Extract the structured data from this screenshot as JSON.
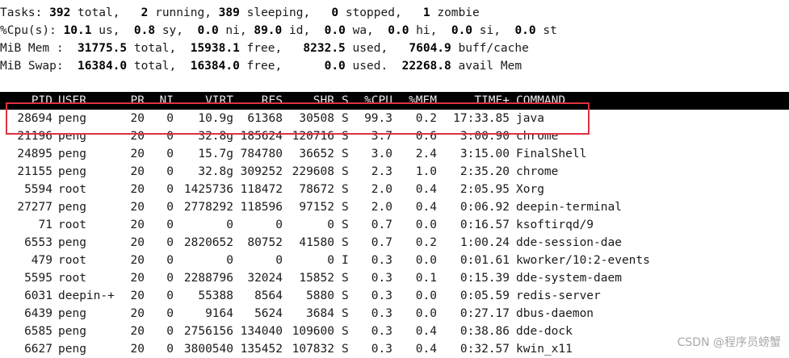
{
  "summary_lines": [
    [
      {
        "t": "Tasks: ",
        "b": false
      },
      {
        "t": "392",
        "b": true
      },
      {
        "t": " total,   ",
        "b": false
      },
      {
        "t": "2",
        "b": true
      },
      {
        "t": " running, ",
        "b": false
      },
      {
        "t": "389",
        "b": true
      },
      {
        "t": " sleeping,   ",
        "b": false
      },
      {
        "t": "0",
        "b": true
      },
      {
        "t": " stopped,   ",
        "b": false
      },
      {
        "t": "1",
        "b": true
      },
      {
        "t": " zombie",
        "b": false
      }
    ],
    [
      {
        "t": "%Cpu(s): ",
        "b": false
      },
      {
        "t": "10.1",
        "b": true
      },
      {
        "t": " us,  ",
        "b": false
      },
      {
        "t": "0.8",
        "b": true
      },
      {
        "t": " sy,  ",
        "b": false
      },
      {
        "t": "0.0",
        "b": true
      },
      {
        "t": " ni, ",
        "b": false
      },
      {
        "t": "89.0",
        "b": true
      },
      {
        "t": " id,  ",
        "b": false
      },
      {
        "t": "0.0",
        "b": true
      },
      {
        "t": " wa,  ",
        "b": false
      },
      {
        "t": "0.0",
        "b": true
      },
      {
        "t": " hi,  ",
        "b": false
      },
      {
        "t": "0.0",
        "b": true
      },
      {
        "t": " si,  ",
        "b": false
      },
      {
        "t": "0.0",
        "b": true
      },
      {
        "t": " st",
        "b": false
      }
    ],
    [
      {
        "t": "MiB Mem :  ",
        "b": false
      },
      {
        "t": "31775.5",
        "b": true
      },
      {
        "t": " total,  ",
        "b": false
      },
      {
        "t": "15938.1",
        "b": true
      },
      {
        "t": " free,   ",
        "b": false
      },
      {
        "t": "8232.5",
        "b": true
      },
      {
        "t": " used,   ",
        "b": false
      },
      {
        "t": "7604.9",
        "b": true
      },
      {
        "t": " buff/cache",
        "b": false
      }
    ],
    [
      {
        "t": "MiB Swap:  ",
        "b": false
      },
      {
        "t": "16384.0",
        "b": true
      },
      {
        "t": " total,  ",
        "b": false
      },
      {
        "t": "16384.0",
        "b": true
      },
      {
        "t": " free,      ",
        "b": false
      },
      {
        "t": "0.0",
        "b": true
      },
      {
        "t": " used.  ",
        "b": false
      },
      {
        "t": "22268.8",
        "b": true
      },
      {
        "t": " avail Mem",
        "b": false
      }
    ]
  ],
  "columns": {
    "pid": "PID",
    "user": "USER",
    "pr": "PR",
    "ni": "NI",
    "virt": "VIRT",
    "res": "RES",
    "shr": "SHR",
    "s": "S",
    "cpu": "%CPU",
    "mem": "%MEM",
    "time": "TIME+",
    "cmd": "COMMAND"
  },
  "processes": [
    {
      "pid": "28694",
      "user": "peng",
      "pr": "20",
      "ni": "0",
      "virt": "10.9g",
      "res": "61368",
      "shr": "30508",
      "s": "S",
      "cpu": "99.3",
      "mem": "0.2",
      "time": "17:33.85",
      "cmd": "java"
    },
    {
      "pid": "21196",
      "user": "peng",
      "pr": "20",
      "ni": "0",
      "virt": "32.8g",
      "res": "185624",
      "shr": "120716",
      "s": "S",
      "cpu": "3.7",
      "mem": "0.6",
      "time": "3:00.90",
      "cmd": "chrome"
    },
    {
      "pid": "24895",
      "user": "peng",
      "pr": "20",
      "ni": "0",
      "virt": "15.7g",
      "res": "784780",
      "shr": "36652",
      "s": "S",
      "cpu": "3.0",
      "mem": "2.4",
      "time": "3:15.00",
      "cmd": "FinalShell"
    },
    {
      "pid": "21155",
      "user": "peng",
      "pr": "20",
      "ni": "0",
      "virt": "32.8g",
      "res": "309252",
      "shr": "229608",
      "s": "S",
      "cpu": "2.3",
      "mem": "1.0",
      "time": "2:35.20",
      "cmd": "chrome"
    },
    {
      "pid": "5594",
      "user": "root",
      "pr": "20",
      "ni": "0",
      "virt": "1425736",
      "res": "118472",
      "shr": "78672",
      "s": "S",
      "cpu": "2.0",
      "mem": "0.4",
      "time": "2:05.95",
      "cmd": "Xorg"
    },
    {
      "pid": "27277",
      "user": "peng",
      "pr": "20",
      "ni": "0",
      "virt": "2778292",
      "res": "118596",
      "shr": "97152",
      "s": "S",
      "cpu": "2.0",
      "mem": "0.4",
      "time": "0:06.92",
      "cmd": "deepin-terminal"
    },
    {
      "pid": "71",
      "user": "root",
      "pr": "20",
      "ni": "0",
      "virt": "0",
      "res": "0",
      "shr": "0",
      "s": "S",
      "cpu": "0.7",
      "mem": "0.0",
      "time": "0:16.57",
      "cmd": "ksoftirqd/9"
    },
    {
      "pid": "6553",
      "user": "peng",
      "pr": "20",
      "ni": "0",
      "virt": "2820652",
      "res": "80752",
      "shr": "41580",
      "s": "S",
      "cpu": "0.7",
      "mem": "0.2",
      "time": "1:00.24",
      "cmd": "dde-session-dae"
    },
    {
      "pid": "479",
      "user": "root",
      "pr": "20",
      "ni": "0",
      "virt": "0",
      "res": "0",
      "shr": "0",
      "s": "I",
      "cpu": "0.3",
      "mem": "0.0",
      "time": "0:01.61",
      "cmd": "kworker/10:2-events"
    },
    {
      "pid": "5595",
      "user": "root",
      "pr": "20",
      "ni": "0",
      "virt": "2288796",
      "res": "32024",
      "shr": "15852",
      "s": "S",
      "cpu": "0.3",
      "mem": "0.1",
      "time": "0:15.39",
      "cmd": "dde-system-daem"
    },
    {
      "pid": "6031",
      "user": "deepin-+",
      "pr": "20",
      "ni": "0",
      "virt": "55388",
      "res": "8564",
      "shr": "5880",
      "s": "S",
      "cpu": "0.3",
      "mem": "0.0",
      "time": "0:05.59",
      "cmd": "redis-server"
    },
    {
      "pid": "6439",
      "user": "peng",
      "pr": "20",
      "ni": "0",
      "virt": "9164",
      "res": "5624",
      "shr": "3684",
      "s": "S",
      "cpu": "0.3",
      "mem": "0.0",
      "time": "0:27.17",
      "cmd": "dbus-daemon"
    },
    {
      "pid": "6585",
      "user": "peng",
      "pr": "20",
      "ni": "0",
      "virt": "2756156",
      "res": "134040",
      "shr": "109600",
      "s": "S",
      "cpu": "0.3",
      "mem": "0.4",
      "time": "0:38.86",
      "cmd": "dde-dock"
    },
    {
      "pid": "6627",
      "user": "peng",
      "pr": "20",
      "ni": "0",
      "virt": "3800540",
      "res": "135452",
      "shr": "107832",
      "s": "S",
      "cpu": "0.3",
      "mem": "0.4",
      "time": "0:32.57",
      "cmd": "kwin_x11"
    }
  ],
  "watermark": "CSDN @程序员螃蟹",
  "colors": {
    "header_bg": "#000000",
    "header_fg": "#e8e8e8",
    "highlight_border": "#e0313f"
  }
}
